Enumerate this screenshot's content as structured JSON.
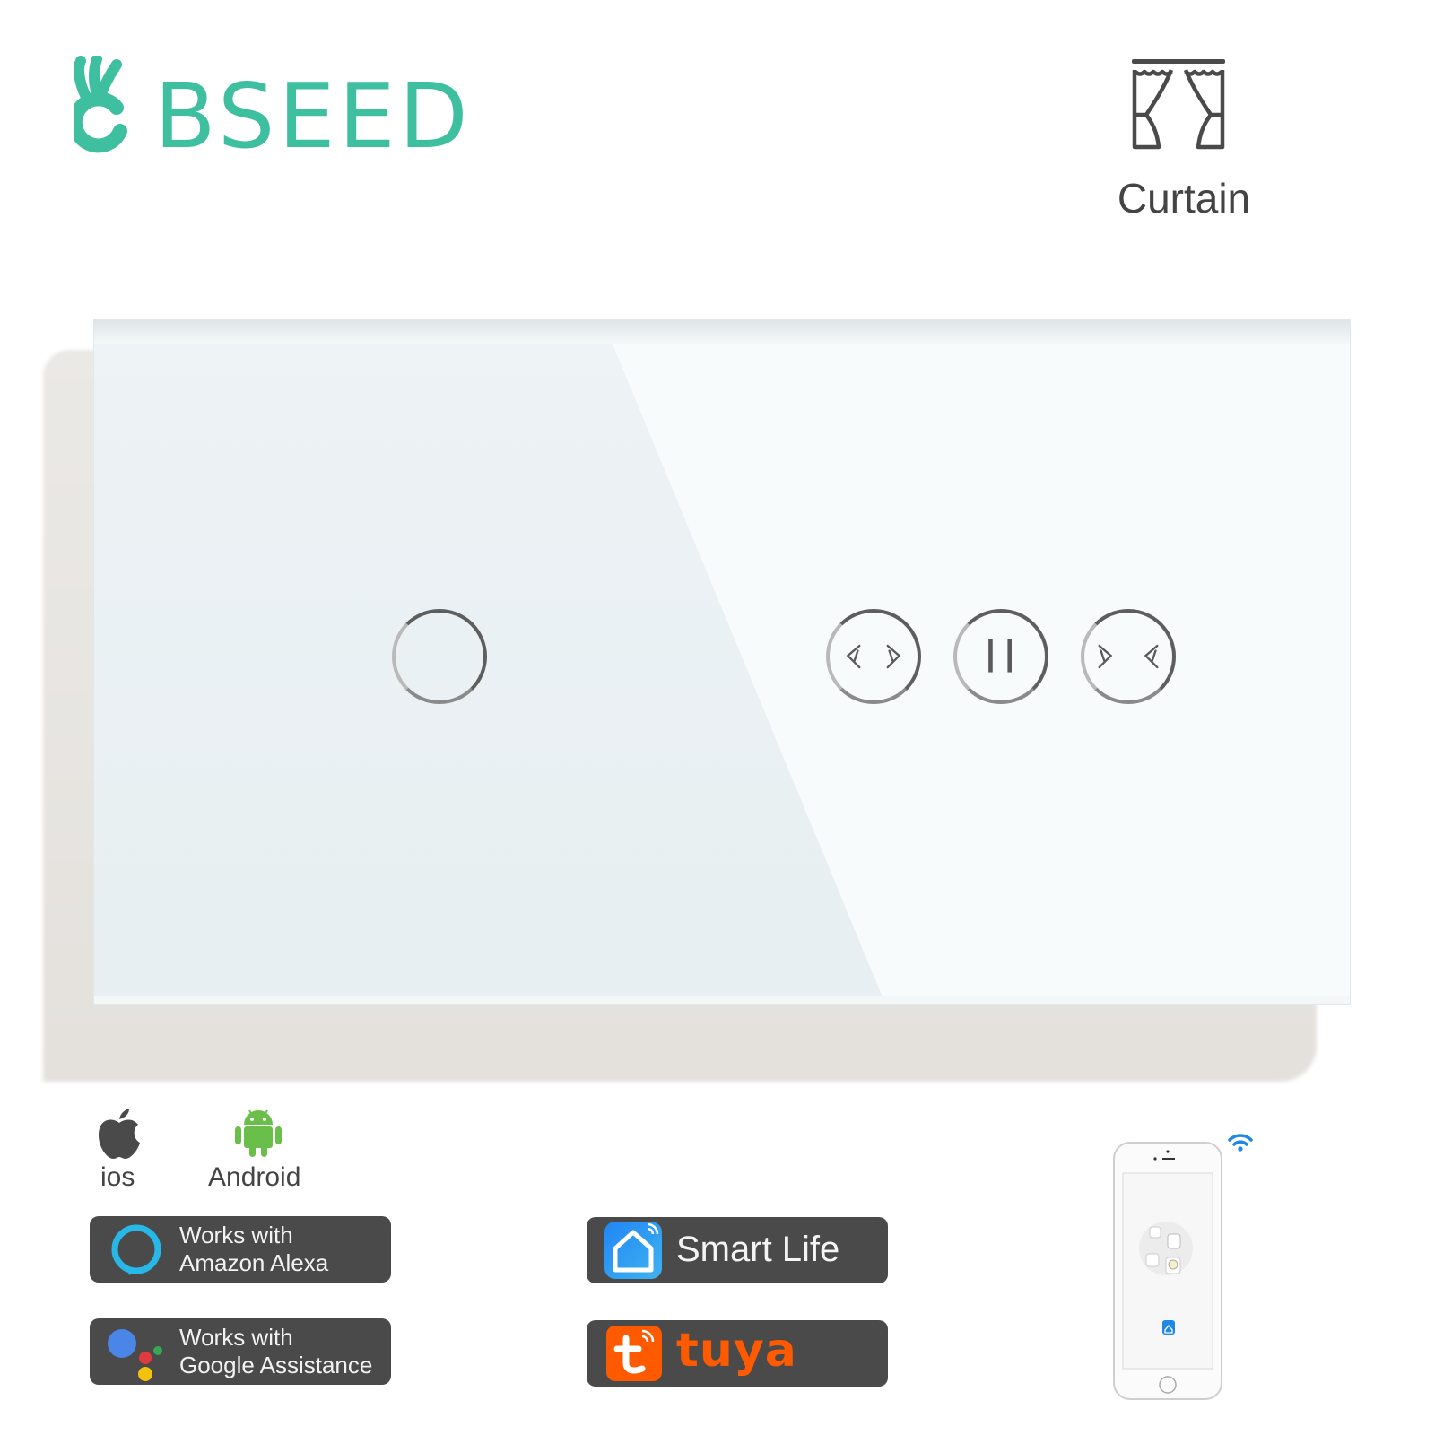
{
  "brand": {
    "name": "BSEED",
    "color": "#3dbfa0"
  },
  "product": {
    "type_label": "Curtain",
    "type_icon": "curtain-icon",
    "buttons": [
      {
        "id": "single",
        "icon": "circle-touch-icon"
      },
      {
        "id": "open",
        "icon": "curtain-open-arrows-icon"
      },
      {
        "id": "pause",
        "icon": "pause-icon"
      },
      {
        "id": "close",
        "icon": "curtain-close-arrows-icon"
      }
    ]
  },
  "platforms": [
    {
      "label": "ios",
      "icon": "apple-icon"
    },
    {
      "label": "Android",
      "icon": "android-icon",
      "color": "#6abf4b"
    }
  ],
  "badges": {
    "alexa": {
      "line1": "Works with",
      "line2": "Amazon Alexa",
      "icon": "alexa-icon",
      "color": "#27b8e8"
    },
    "google": {
      "line1": "Works with",
      "line2": "Google Assistance",
      "icon": "google-assistant-icon",
      "colors": [
        "#4a86e8",
        "#e03a3e",
        "#f4c20d",
        "#34a853"
      ]
    },
    "smartlife": {
      "label": "Smart Life",
      "icon": "smart-life-house-icon",
      "color": "#2f8cf0"
    },
    "tuya": {
      "label": "tuya",
      "icon": "tuya-t-icon",
      "color": "#ff5a00"
    }
  },
  "phone": {
    "icon": "smartphone-icon",
    "wifi_icon": "wifi-icon",
    "wifi_color": "#1e88e5"
  }
}
